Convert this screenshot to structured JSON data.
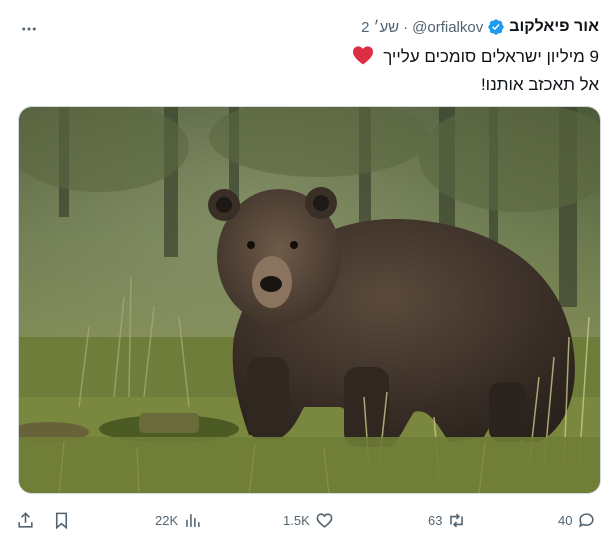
{
  "tweet": {
    "author_name": "אור פיאלקוב",
    "handle": "@orfialkov",
    "separator": "·",
    "time": "2 שע׳",
    "line1": "9 מיליון ישראלים סומכים עלייך",
    "line2": "אל תאכזב אותנו!",
    "image_subject": "brown bear in a forest meadow"
  },
  "actions": {
    "replies": "40",
    "retweets": "63",
    "likes": "1.5K",
    "views": "22K"
  },
  "colors": {
    "text_primary": "#0f1419",
    "text_secondary": "#536471",
    "verified_blue": "#1d9bf0",
    "heart_red": "#dd2e44",
    "border": "#cfd9de"
  },
  "icons": [
    "more-icon",
    "verified-badge-icon",
    "red-heart-emoji",
    "share-icon",
    "bookmark-icon",
    "views-icon",
    "like-icon",
    "retweet-icon",
    "reply-icon"
  ]
}
